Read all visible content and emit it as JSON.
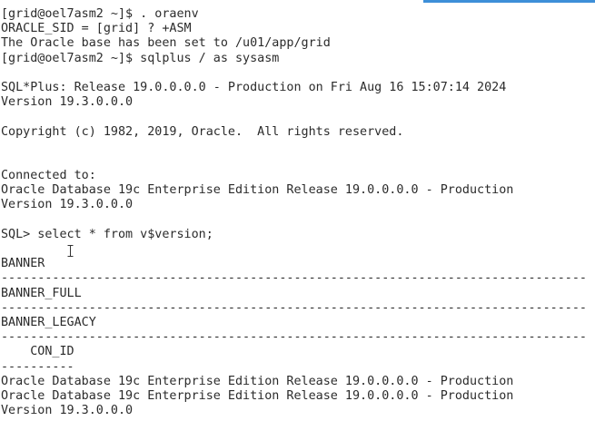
{
  "terminal": {
    "lines": [
      "[grid@oel7asm2 ~]$ . oraenv",
      "ORACLE_SID = [grid] ? +ASM",
      "The Oracle base has been set to /u01/app/grid",
      "[grid@oel7asm2 ~]$ sqlplus / as sysasm",
      "",
      "SQL*Plus: Release 19.0.0.0.0 - Production on Fri Aug 16 15:07:14 2024",
      "Version 19.3.0.0.0",
      "",
      "Copyright (c) 1982, 2019, Oracle.  All rights reserved.",
      "",
      "",
      "Connected to:",
      "Oracle Database 19c Enterprise Edition Release 19.0.0.0.0 - Production",
      "Version 19.3.0.0.0",
      "",
      "SQL> select * from v$version;",
      "",
      "BANNER",
      "--------------------------------------------------------------------------------",
      "BANNER_FULL",
      "--------------------------------------------------------------------------------",
      "BANNER_LEGACY",
      "--------------------------------------------------------------------------------",
      "    CON_ID",
      "----------",
      "Oracle Database 19c Enterprise Edition Release 19.0.0.0.0 - Production",
      "Oracle Database 19c Enterprise Edition Release 19.0.0.0.0 - Production",
      "Version 19.3.0.0.0"
    ]
  },
  "colors": {
    "background": "#ffffff",
    "text": "#2b2b2b",
    "accent": "#3d8fd8"
  }
}
